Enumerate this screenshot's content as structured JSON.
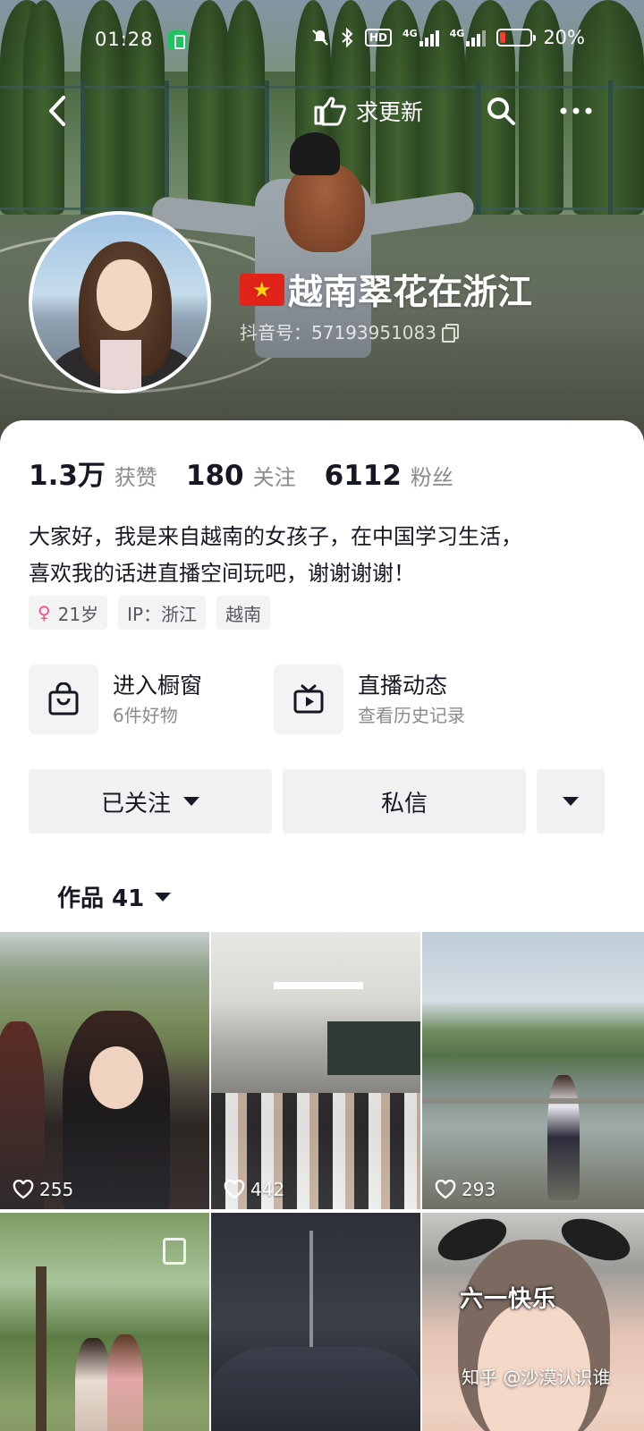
{
  "status_bar": {
    "time": "01:28",
    "network_badge": "HD",
    "network_1": "4G",
    "network_2": "4G",
    "battery_percent": "20%"
  },
  "nav": {
    "request_update_label": "求更新"
  },
  "profile": {
    "nickname": "越南翠花在浙江",
    "douyin_id": "抖音号：57193951083",
    "stats": [
      {
        "value": "1.3万",
        "label": "获赞"
      },
      {
        "value": "180",
        "label": "关注"
      },
      {
        "value": "6112",
        "label": "粉丝"
      }
    ],
    "bio_line1": "大家好，我是来自越南的女孩子，在中国学习生活，",
    "bio_line2": "喜欢我的话进直播空间玩吧，谢谢谢谢！",
    "tags": [
      "21岁",
      "IP：浙江",
      "越南"
    ]
  },
  "entries": [
    {
      "title": "进入橱窗",
      "subtitle": "6件好物",
      "icon": "shopping-bag-icon"
    },
    {
      "title": "直播动态",
      "subtitle": "查看历史记录",
      "icon": "tv-play-icon"
    }
  ],
  "actions": {
    "follow_label": "已关注",
    "message_label": "私信"
  },
  "works_tab": {
    "label": "作品 41"
  },
  "videos": [
    {
      "likes": "255"
    },
    {
      "likes": "442"
    },
    {
      "likes": "293"
    },
    {
      "likes": ""
    },
    {
      "likes": ""
    },
    {
      "likes": ""
    }
  ],
  "thumbnail_caption": "六一快乐",
  "watermark": "知乎 @沙漠认识谁",
  "colors": {
    "female_tag": "#f64a8a",
    "flag_red": "#e2231a",
    "flag_star": "#ffd40c",
    "battery_low": "#ff3b30",
    "battery_saver": "#20c35f"
  }
}
